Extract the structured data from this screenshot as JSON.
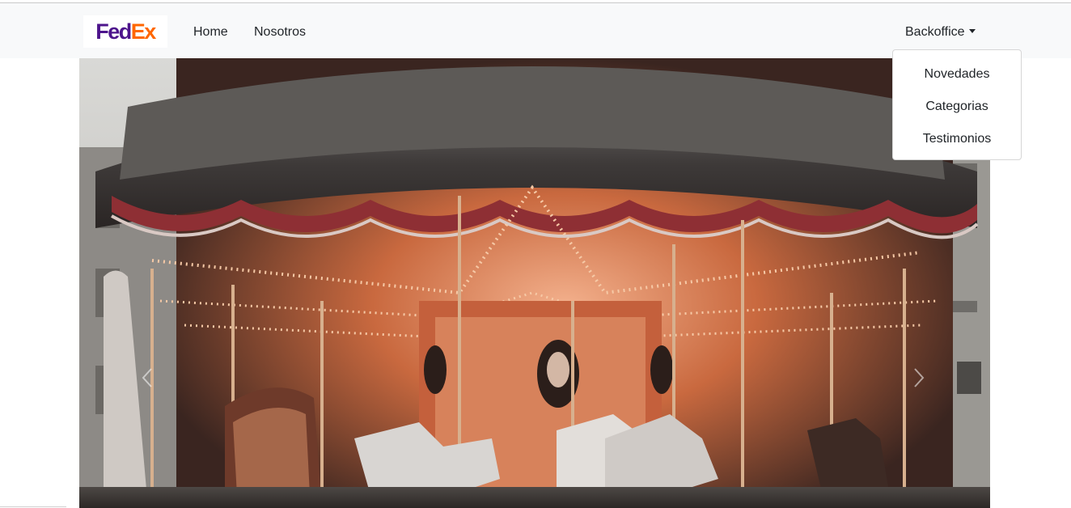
{
  "navbar": {
    "logo": {
      "part1": "Fed",
      "part2": "Ex",
      "color1": "#4d148c",
      "color2": "#ff6600"
    },
    "links": [
      {
        "label": "Home"
      },
      {
        "label": "Nosotros"
      }
    ],
    "dropdown": {
      "label": "Backoffice",
      "items": [
        {
          "label": "Novedades"
        },
        {
          "label": "Categorias"
        },
        {
          "label": "Testimonios"
        }
      ]
    }
  },
  "carousel": {
    "slide_description": "carousel",
    "controls": {
      "prev_icon": "chevron-left-icon",
      "next_icon": "chevron-right-icon"
    }
  },
  "colors": {
    "navbar_bg": "#f8f9fa",
    "text": "#212529"
  }
}
